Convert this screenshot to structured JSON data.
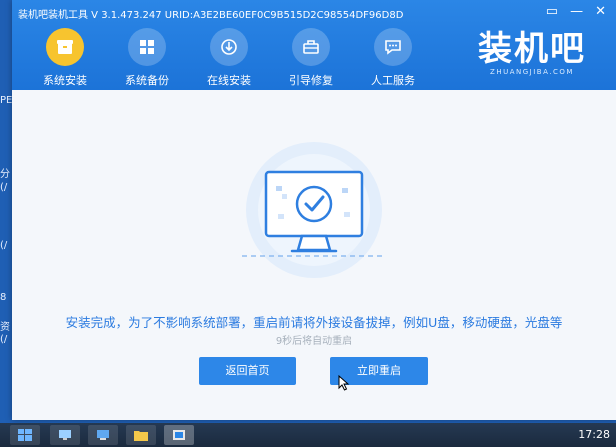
{
  "window": {
    "title": "装机吧装机工具 V 3.1.473.247 URID:A3E2BE60EF0C9B515D2C98554DF96D8D",
    "controls": [
      "▭",
      "—",
      "✕"
    ]
  },
  "nav": [
    {
      "label": "系统安装",
      "icon": "box-icon",
      "active": true
    },
    {
      "label": "系统备份",
      "icon": "windows-icon",
      "active": false
    },
    {
      "label": "在线安装",
      "icon": "download-icon",
      "active": false
    },
    {
      "label": "引导修复",
      "icon": "toolbox-icon",
      "active": false
    },
    {
      "label": "人工服务",
      "icon": "chat-icon",
      "active": false
    }
  ],
  "brand": {
    "name": "装机吧",
    "url": "ZHUANGJIBA.COM"
  },
  "main": {
    "message": "安装完成，为了不影响系统部署，重启前请将外接设备拔掉，例如U盘，移动硬盘，光盘等",
    "countdown": "9秒后将自动重启",
    "home_button": "返回首页",
    "restart_button": "立即重启"
  },
  "desktop_fragments": [
    "PE",
    "分",
    "(/",
    "(/",
    "8",
    "资",
    "(/"
  ],
  "taskbar": {
    "clock": "17:28"
  },
  "colors": {
    "accent": "#2d87e8",
    "header": "#1c73d8",
    "active_nav": "#f7c42f",
    "message_text": "#2b7be0"
  }
}
